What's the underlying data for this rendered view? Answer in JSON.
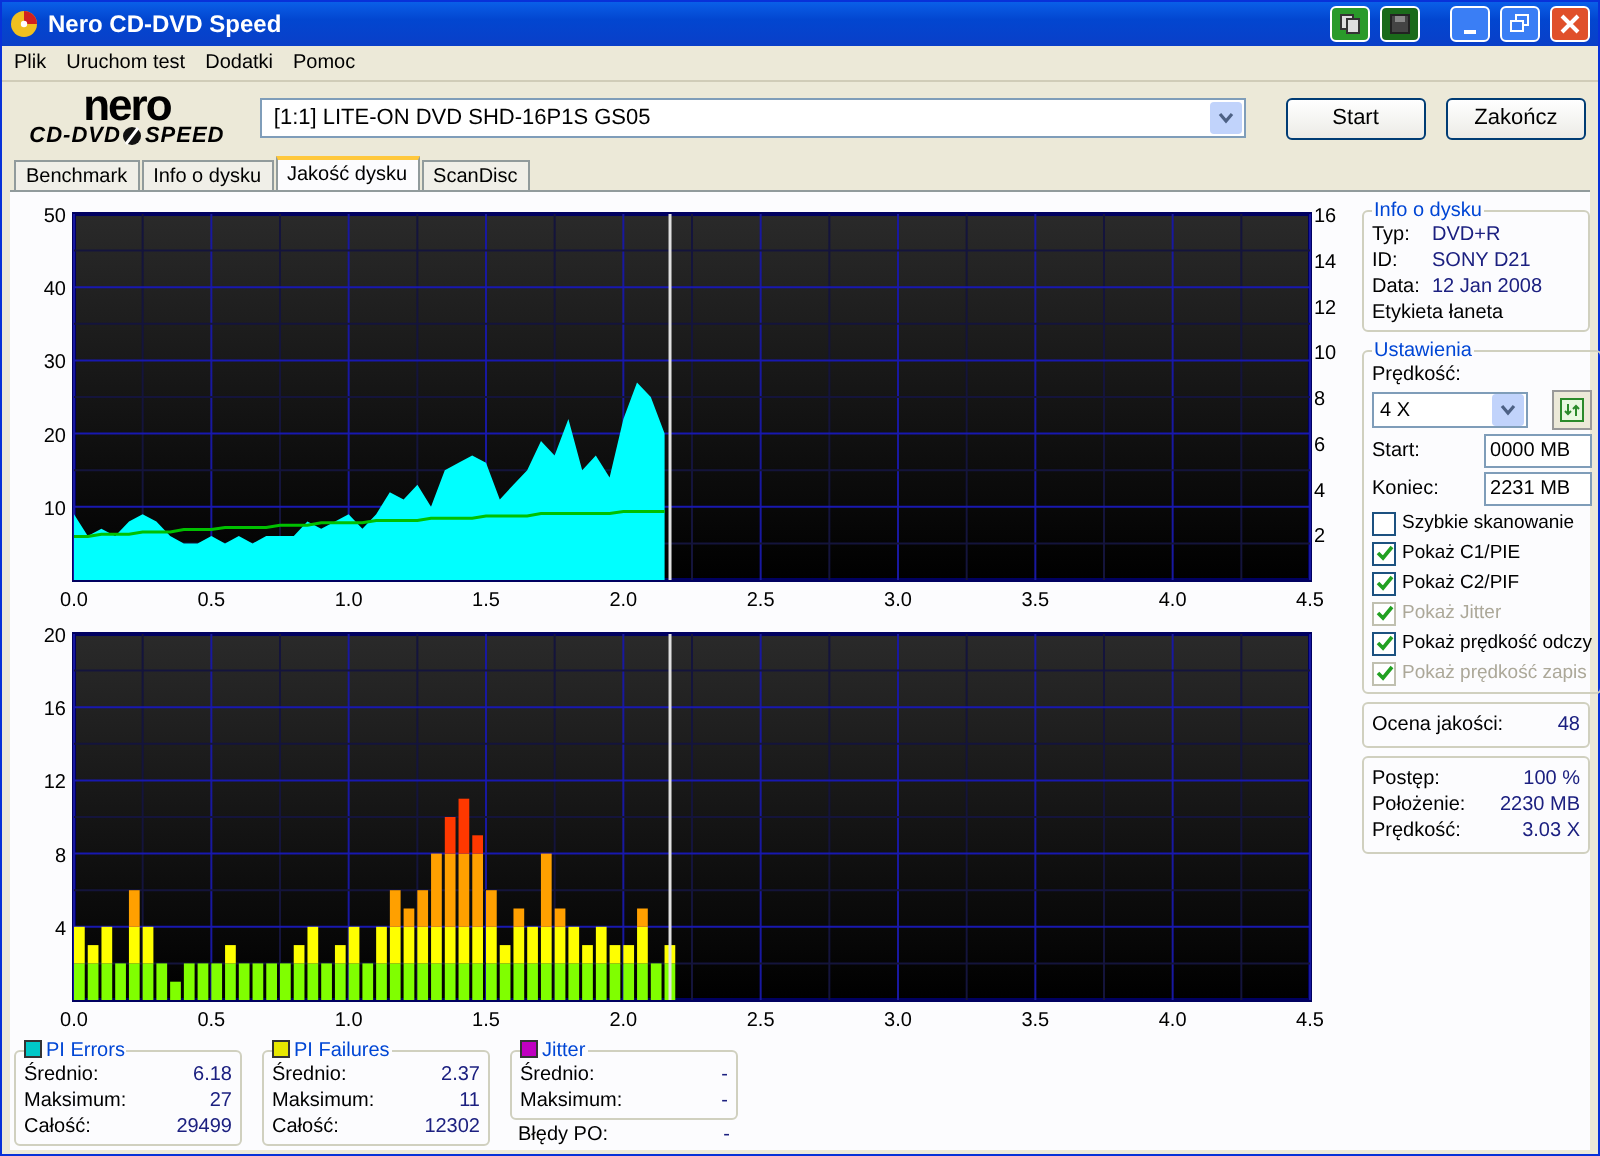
{
  "window": {
    "title": "Nero CD-DVD Speed"
  },
  "menu": [
    "Plik",
    "Uruchom test",
    "Dodatki",
    "Pomoc"
  ],
  "logo": {
    "brand": "nero",
    "left": "CD-DVD",
    "right": "SPEED"
  },
  "drive": {
    "value": "[1:1]  LITE-ON DVD SHD-16P1S GS05"
  },
  "buttons": [
    "Start",
    "Zakończ"
  ],
  "tabs": [
    {
      "label": "Benchmark",
      "selected": false
    },
    {
      "label": "Info o dysku",
      "selected": false
    },
    {
      "label": "Jakość dysku",
      "selected": true
    },
    {
      "label": "ScanDisc",
      "selected": false
    }
  ],
  "charts": [
    {
      "chart_data": {
        "type": "area",
        "grid": true,
        "y2lim": [
          0,
          16
        ],
        "y2ticks": [
          16,
          14,
          12,
          10,
          8,
          6,
          4,
          2
        ],
        "ref_lines": [
          {
            "axis": "x",
            "value": 2.17,
            "color": "#e0e0e0"
          }
        ],
        "xlim": [
          0,
          4.5
        ],
        "ylim": [
          0,
          50
        ],
        "xticks": [
          {
            "value": 0,
            "label": "0.0"
          },
          {
            "value": 0.5,
            "label": "0.5"
          },
          {
            "value": 1,
            "label": "1.0"
          },
          {
            "value": 1.5,
            "label": "1.5"
          },
          {
            "value": 2,
            "label": "2.0"
          },
          {
            "value": 2.5,
            "label": "2.5"
          },
          {
            "value": 3,
            "label": "3.0"
          },
          {
            "value": 3.5,
            "label": "3.5"
          },
          {
            "value": 4,
            "label": "4.0"
          },
          {
            "value": 4.5,
            "label": "4.5"
          }
        ],
        "yticks": [
          10,
          20,
          30,
          40,
          50
        ],
        "x": [
          0,
          0.05,
          0.1,
          0.15,
          0.2,
          0.25,
          0.3,
          0.35,
          0.4,
          0.45,
          0.5,
          0.55,
          0.6,
          0.65,
          0.7,
          0.75,
          0.8,
          0.85,
          0.9,
          0.95,
          1,
          1.05,
          1.1,
          1.15,
          1.2,
          1.25,
          1.3,
          1.35,
          1.4,
          1.45,
          1.5,
          1.55,
          1.6,
          1.65,
          1.7,
          1.75,
          1.8,
          1.85,
          1.9,
          1.95,
          2,
          2.05,
          2.1,
          2.15
        ],
        "series": [
          {
            "color": "#00ffff",
            "values": [
              9,
              6,
              7,
              6,
              8,
              9,
              8,
              6,
              5,
              5,
              6,
              5,
              6,
              5,
              6,
              6,
              6,
              8,
              7,
              8,
              9,
              7,
              9,
              12,
              11,
              13,
              10,
              15,
              16,
              17,
              16,
              11,
              13,
              15,
              19,
              17,
              22,
              15,
              17,
              14,
              22,
              27,
              25,
              20
            ]
          },
          {
            "color": "#00c000",
            "axis": "y2",
            "type": "line",
            "values": [
              1.9,
              1.9,
              2,
              2,
              2,
              2.1,
              2.1,
              2.1,
              2.2,
              2.2,
              2.2,
              2.3,
              2.3,
              2.3,
              2.3,
              2.4,
              2.4,
              2.4,
              2.5,
              2.5,
              2.5,
              2.5,
              2.6,
              2.6,
              2.6,
              2.6,
              2.7,
              2.7,
              2.7,
              2.7,
              2.8,
              2.8,
              2.8,
              2.8,
              2.9,
              2.9,
              2.9,
              2.9,
              2.9,
              2.9,
              3,
              3,
              3,
              3
            ]
          }
        ]
      }
    },
    {
      "chart_data": {
        "type": "bar",
        "stacked": true,
        "grid": true,
        "ref_lines": [
          {
            "axis": "x",
            "value": 2.17,
            "color": "#e0e0e0"
          }
        ],
        "xlim": [
          0,
          4.5
        ],
        "ylim": [
          0,
          20
        ],
        "xticks": [
          {
            "value": 0,
            "label": "0.0"
          },
          {
            "value": 0.5,
            "label": "0.5"
          },
          {
            "value": 1,
            "label": "1.0"
          },
          {
            "value": 1.5,
            "label": "1.5"
          },
          {
            "value": 2,
            "label": "2.0"
          },
          {
            "value": 2.5,
            "label": "2.5"
          },
          {
            "value": 3,
            "label": "3.0"
          },
          {
            "value": 3.5,
            "label": "3.5"
          },
          {
            "value": 4,
            "label": "4.0"
          },
          {
            "value": 4.5,
            "label": "4.5"
          }
        ],
        "yticks": [
          4,
          8,
          12,
          16,
          20
        ],
        "x": [
          0,
          0.05,
          0.1,
          0.15,
          0.2,
          0.25,
          0.3,
          0.35,
          0.4,
          0.45,
          0.5,
          0.55,
          0.6,
          0.65,
          0.7,
          0.75,
          0.8,
          0.85,
          0.9,
          0.95,
          1,
          1.05,
          1.1,
          1.15,
          1.2,
          1.25,
          1.3,
          1.35,
          1.4,
          1.45,
          1.5,
          1.55,
          1.6,
          1.65,
          1.7,
          1.75,
          1.8,
          1.85,
          1.9,
          1.95,
          2,
          2.05,
          2.1,
          2.15
        ],
        "series": [
          {
            "color": "#80ff00",
            "values": [
              2,
              2,
              2,
              2,
              2,
              2,
              2,
              1,
              2,
              2,
              2,
              2,
              2,
              2,
              2,
              2,
              2,
              2,
              2,
              2,
              2,
              2,
              2,
              2,
              2,
              2,
              2,
              2,
              2,
              2,
              2,
              2,
              2,
              2,
              2,
              2,
              2,
              2,
              2,
              2,
              2,
              2,
              2,
              2
            ]
          },
          {
            "color": "#ffff00",
            "values": [
              2,
              1,
              2,
              0,
              2,
              2,
              0,
              0,
              0,
              0,
              0,
              1,
              0,
              0,
              0,
              0,
              1,
              2,
              0,
              1,
              2,
              0,
              2,
              2,
              2,
              2,
              2,
              2,
              2,
              2,
              2,
              1,
              2,
              2,
              2,
              2,
              2,
              1,
              2,
              1,
              1,
              2,
              0,
              1
            ]
          },
          {
            "color": "#ffa000",
            "values": [
              0,
              0,
              0,
              0,
              2,
              0,
              0,
              0,
              0,
              0,
              0,
              0,
              0,
              0,
              0,
              0,
              0,
              0,
              0,
              0,
              0,
              0,
              0,
              2,
              1,
              2,
              4,
              4,
              4,
              4,
              2,
              0,
              1,
              0,
              4,
              1,
              0,
              0,
              0,
              0,
              0,
              1,
              0,
              0
            ]
          },
          {
            "color": "#ff3800",
            "values": [
              0,
              0,
              0,
              0,
              0,
              0,
              0,
              0,
              0,
              0,
              0,
              0,
              0,
              0,
              0,
              0,
              0,
              0,
              0,
              0,
              0,
              0,
              0,
              0,
              0,
              0,
              0,
              2,
              3,
              1,
              0,
              0,
              0,
              0,
              0,
              0,
              0,
              0,
              0,
              0,
              0,
              0,
              0,
              0
            ]
          }
        ]
      }
    }
  ],
  "disc_info": {
    "title": "Info o dysku",
    "rows": [
      {
        "label": "Typ:",
        "value": "DVD+R"
      },
      {
        "label": "ID:",
        "value": "SONY D21"
      },
      {
        "label": "Data:",
        "value": "12 Jan 2008"
      }
    ],
    "note": "Etykieta łaneta"
  },
  "settings": {
    "title": "Ustawienia",
    "speed_label": "Prędkość:",
    "speed": "4 X",
    "start_label": "Start:",
    "start": "0000 MB",
    "end_label": "Koniec:",
    "end": "2231 MB",
    "options": [
      {
        "label": "Szybkie skanowanie",
        "checked": false,
        "disabled": false
      },
      {
        "label": "Pokaż C1/PIE",
        "checked": true,
        "disabled": false
      },
      {
        "label": "Pokaż C2/PIF",
        "checked": true,
        "disabled": false
      },
      {
        "label": "Pokaż Jitter",
        "checked": true,
        "disabled": true
      },
      {
        "label": "Pokaż prędkość odczy",
        "checked": true,
        "disabled": false
      },
      {
        "label": "Pokaż prędkość zapis",
        "checked": true,
        "disabled": true
      }
    ]
  },
  "quality": {
    "label": "Ocena jakości:",
    "value": "48"
  },
  "progress": [
    {
      "label": "Postęp:",
      "value": "100 %"
    },
    {
      "label": "Położenie:",
      "value": "2230 MB"
    },
    {
      "label": "Prędkość:",
      "value": "3.03 X"
    }
  ],
  "stats": [
    {
      "title": "PI Errors",
      "color": "#00c8c8",
      "rows": [
        {
          "label": "Średnio:",
          "value": "6.18"
        },
        {
          "label": "Maksimum:",
          "value": "27"
        },
        {
          "label": "Całość:",
          "value": "29499"
        }
      ]
    },
    {
      "title": "PI Failures",
      "color": "#e8e800",
      "rows": [
        {
          "label": "Średnio:",
          "value": "2.37"
        },
        {
          "label": "Maksimum:",
          "value": "11"
        },
        {
          "label": "Całość:",
          "value": "12302"
        }
      ]
    },
    {
      "title": "Jitter",
      "color": "#c000c0",
      "rows": [
        {
          "label": "Średnio:",
          "value": "-"
        },
        {
          "label": "Maksimum:",
          "value": "-"
        }
      ]
    }
  ],
  "po_errors": {
    "label": "Błędy PO:",
    "value": "-"
  }
}
